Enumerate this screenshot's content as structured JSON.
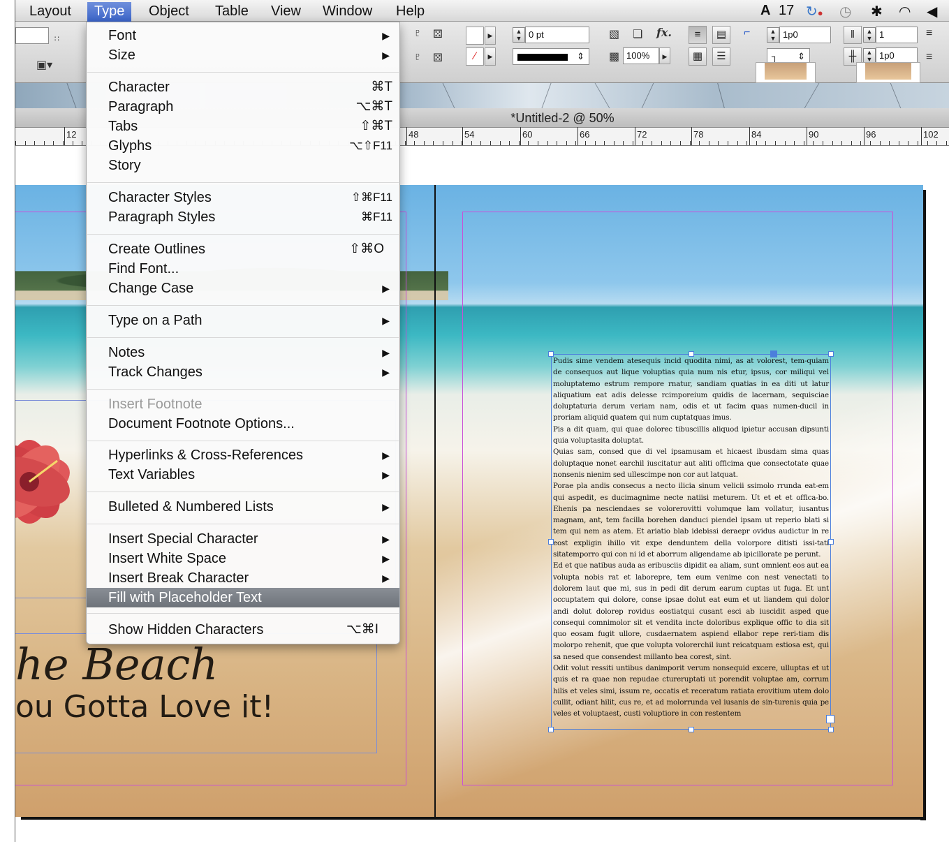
{
  "menubar": {
    "items": [
      "Layout",
      "Type",
      "Object",
      "Table",
      "View",
      "Window",
      "Help"
    ],
    "active": "Type",
    "status": {
      "adobe_count": "17"
    }
  },
  "control": {
    "stroke_weight": "0 pt",
    "zoom": "100%",
    "gutter_1": "1p0",
    "gutter_2": "1p0",
    "columns": "1"
  },
  "document": {
    "tab_title": "*Untitled-2 @ 50%"
  },
  "ruler": {
    "labels": [
      "12",
      "48",
      "54",
      "60",
      "66",
      "72",
      "78",
      "84",
      "90",
      "96",
      "102"
    ]
  },
  "type_menu": {
    "font": "Font",
    "size": "Size",
    "character": "Character",
    "character_sc": "⌘T",
    "paragraph": "Paragraph",
    "paragraph_sc": "⌥⌘T",
    "tabs": "Tabs",
    "tabs_sc": "⇧⌘T",
    "glyphs": "Glyphs",
    "glyphs_sc": "⌥⇧F11",
    "story": "Story",
    "character_styles": "Character Styles",
    "character_styles_sc": "⇧⌘F11",
    "paragraph_styles": "Paragraph Styles",
    "paragraph_styles_sc": "⌘F11",
    "create_outlines": "Create Outlines",
    "create_outlines_sc": "⇧⌘O",
    "find_font": "Find Font...",
    "change_case": "Change Case",
    "type_on_path": "Type on a Path",
    "notes": "Notes",
    "track_changes": "Track Changes",
    "insert_footnote": "Insert Footnote",
    "document_footnote_options": "Document Footnote Options...",
    "hyperlinks": "Hyperlinks & Cross-References",
    "text_variables": "Text Variables",
    "bulleted_lists": "Bulleted & Numbered Lists",
    "insert_special": "Insert Special Character",
    "insert_white": "Insert White Space",
    "insert_break": "Insert Break Character",
    "fill_placeholder": "Fill with Placeholder Text",
    "show_hidden": "Show Hidden Characters",
    "show_hidden_sc": "⌥⌘I"
  },
  "page": {
    "title": "he Beach",
    "subtitle": "ou Gotta Love it!"
  },
  "placeholder_text": [
    "Pudis sime vendem atesequis incid quodita nimi, as at volorest, tem-quiam de consequos aut lique voluptias quia num nis etur, ipsus, cor miliqui vel moluptatemo estrum rempore rnatur, sandiam quatias in ea diti ut latur aliquatium eat adis delesse rcimporeium quidis de lacernam, sequisciae doluptaturia derum veriam nam, odis et ut facim quas numen-ducil in proriam aliquid quatem qui num cuptatquas imus.",
    "Pis a dit quam, qui quae dolorec tibuscillis aliquod ipietur accusan dipsunti quia voluptasita doluptat.",
    "Quias sam, consed que di vel ipsamusam et hicaest ibusdam sima quas doluptaque nonet earchil iuscitatur aut aliti officima que consectotate quae nonsenis nienim sed ullescimpe non cor aut latquat.",
    "Porae pla andis consecus a necto ilicia sinum velicii ssimolo rrunda eat-em qui aspedit, es ducimagnime necte natiisi meturem. Ut et et et offica-bo. Ehenis pa nesciendaes se volorerovitti volumque lam vollatur, iusantus magnam, ant, tem facilla borehen danduci piendel ipsam ut reperio blati si tem qui nem as atem. Et ariatio blab idebissi deraepr ovidus audictur in re eost expligin ihillo vit expe denduntem della volorpore ditisti issi-tati sitatemporro qui con ni id et aborrum aligendame ab ipicillorate pe perunt.",
    "Ed et que natibus auda as eribusciis dipidit ea aliam, sunt omnient eos aut ea volupta nobis rat et laborepre, tem eum venime con nest venectati to dolorem laut que mi, sus in pedi dit derum earum cuptas ut fuga. Et unt occuptatem qui dolore, conse ipsae dolut eat eum et ut liandem qui dolor andi dolut dolorep rovidus eostiatqui cusant esci ab iuscidit asped que consequi comnimolor sit et vendita incte doloribus explique offic to dia sit quo eosam fugit ullore, cusdaernatem aspiend ellabor repe reri-tiam dis molorpo rehenit, que que volupta volorerchil iunt reicatquam estiosa est, qui sa nesed que consendest millanto bea corest, sint.",
    "Odit volut ressiti untibus danimporit verum nonsequid excere, ulluptas et ut quis et ra quae non repudae ctureruptati ut porendit voluptae am, corrum hilis et veles simi, issum re, occatis et receratum ratiata erovitium utem dolo cullit, odiant hilit, cus re, et ad molorrunda vel iusanis de sin-turenis quia pe veles et voluptaest, custi voluptiore in con restentem"
  ],
  "colors": {
    "menu_highlight": "#6e737a",
    "margin_guide": "#c94fd8",
    "frame_blue": "#4c7fdc",
    "menubar_active": "#3a63c7"
  }
}
